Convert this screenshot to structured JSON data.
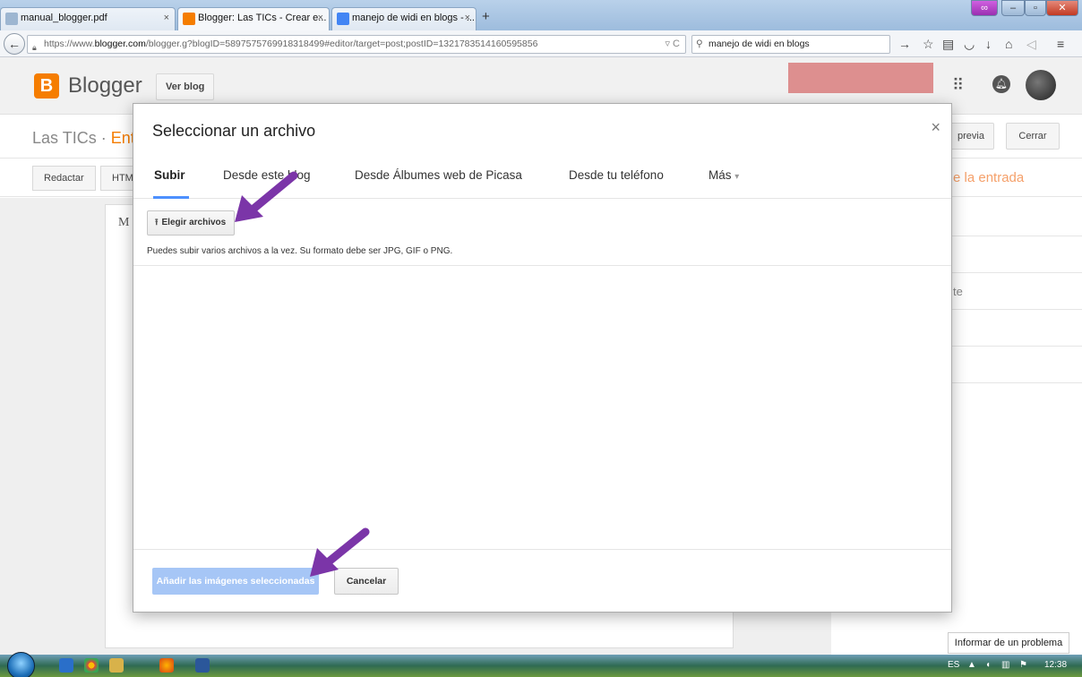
{
  "browser": {
    "tabs": [
      {
        "title": "manual_blogger.pdf",
        "favicon_color": "#9db6d1"
      },
      {
        "title": "Blogger: Las TICs - Crear e...",
        "favicon_color": "#f57d00"
      },
      {
        "title": "manejo de widi en blogs - ...",
        "favicon_color": "#4285f4"
      }
    ],
    "new_tab_label": "+",
    "close_tab_label": "×",
    "url_prefix": "https://www.",
    "url_host": "blogger.com",
    "url_rest": "/blogger.g?blogID=5897575769918318499#editor/target=post;postID=1321783514160595856",
    "search_value": "manejo de widi en blogs"
  },
  "blogger": {
    "logo_letter": "B",
    "brand": "Blogger",
    "view_blog": "Ver blog",
    "site_title": "Las TICs · ",
    "site_title_accent": "Ent",
    "preview_label": "previa",
    "close_label": "Cerrar",
    "editor_tabs": [
      "Redactar",
      "HTM"
    ],
    "settings_title": "e la entrada",
    "sidebar_fragment": "te",
    "editor_placeholder": "M"
  },
  "modal": {
    "title": "Seleccionar un archivo",
    "close_glyph": "×",
    "tabs": [
      "Subir",
      "Desde este blog",
      "Desde Álbumes web de Picasa",
      "Desde tu teléfono",
      "Más"
    ],
    "more_caret": "▾",
    "choose_button": "Elegir archivos",
    "upload_glyph": "⭱",
    "hint": "Puedes subir varios archivos a la vez. Su formato debe ser JPG, GIF o PNG.",
    "add_button": "Añadir las imágenes seleccionadas",
    "cancel_button": "Cancelar"
  },
  "report_problem": "Informar de un problema",
  "taskbar": {
    "lang": "ES",
    "time": "12:38"
  },
  "colors": {
    "accent_orange": "#f57d00",
    "annotation_arrow": "#7b35a8",
    "primary_blue_disabled": "#a6c6f6"
  }
}
